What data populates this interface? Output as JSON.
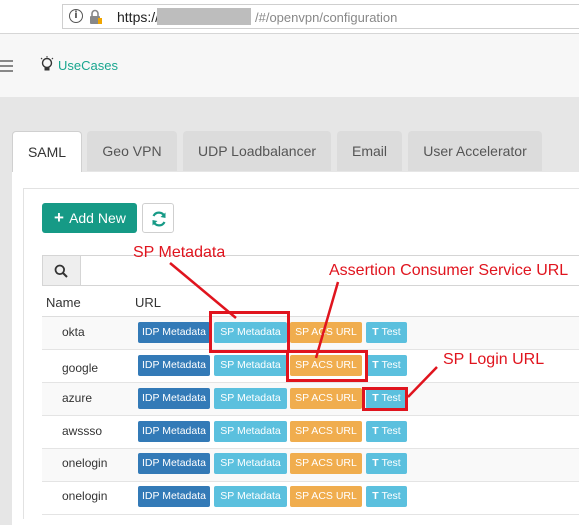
{
  "browser": {
    "url_scheme": "https://",
    "url_path": "/#/openvpn/configuration",
    "icons": [
      "info-icon",
      "lock-icon"
    ]
  },
  "app": {
    "brand": "UseCases",
    "icons": [
      "hamburger-menu-icon",
      "lightbulb-icon"
    ],
    "accent_color": "#169a86"
  },
  "tabs": [
    {
      "label": "SAML",
      "active": true
    },
    {
      "label": "Geo VPN",
      "active": false
    },
    {
      "label": "UDP Loadbalancer",
      "active": false
    },
    {
      "label": "Email",
      "active": false
    },
    {
      "label": "User Accelerator",
      "active": false
    }
  ],
  "toolbar": {
    "add_label": "Add New",
    "add_icon": "+",
    "refresh_icon": "refresh-icon"
  },
  "search": {
    "placeholder": "",
    "icon": "search-icon"
  },
  "table": {
    "headers": {
      "name": "Name",
      "url": "URL"
    },
    "button_labels": {
      "idp": "IDP Metadata",
      "sp": "SP Metadata",
      "acs": "SP ACS URL",
      "test": "Test",
      "test_icon": "T"
    },
    "rows": [
      {
        "name": "okta"
      },
      {
        "name": "google"
      },
      {
        "name": "azure"
      },
      {
        "name": "awssso"
      },
      {
        "name": "onelogin"
      },
      {
        "name": "onelogin"
      }
    ]
  },
  "annotations": {
    "sp_metadata": "SP Metadata",
    "acs_url": "Assertion Consumer Service URL",
    "login_url": "SP Login URL",
    "color": "#e0141e"
  }
}
